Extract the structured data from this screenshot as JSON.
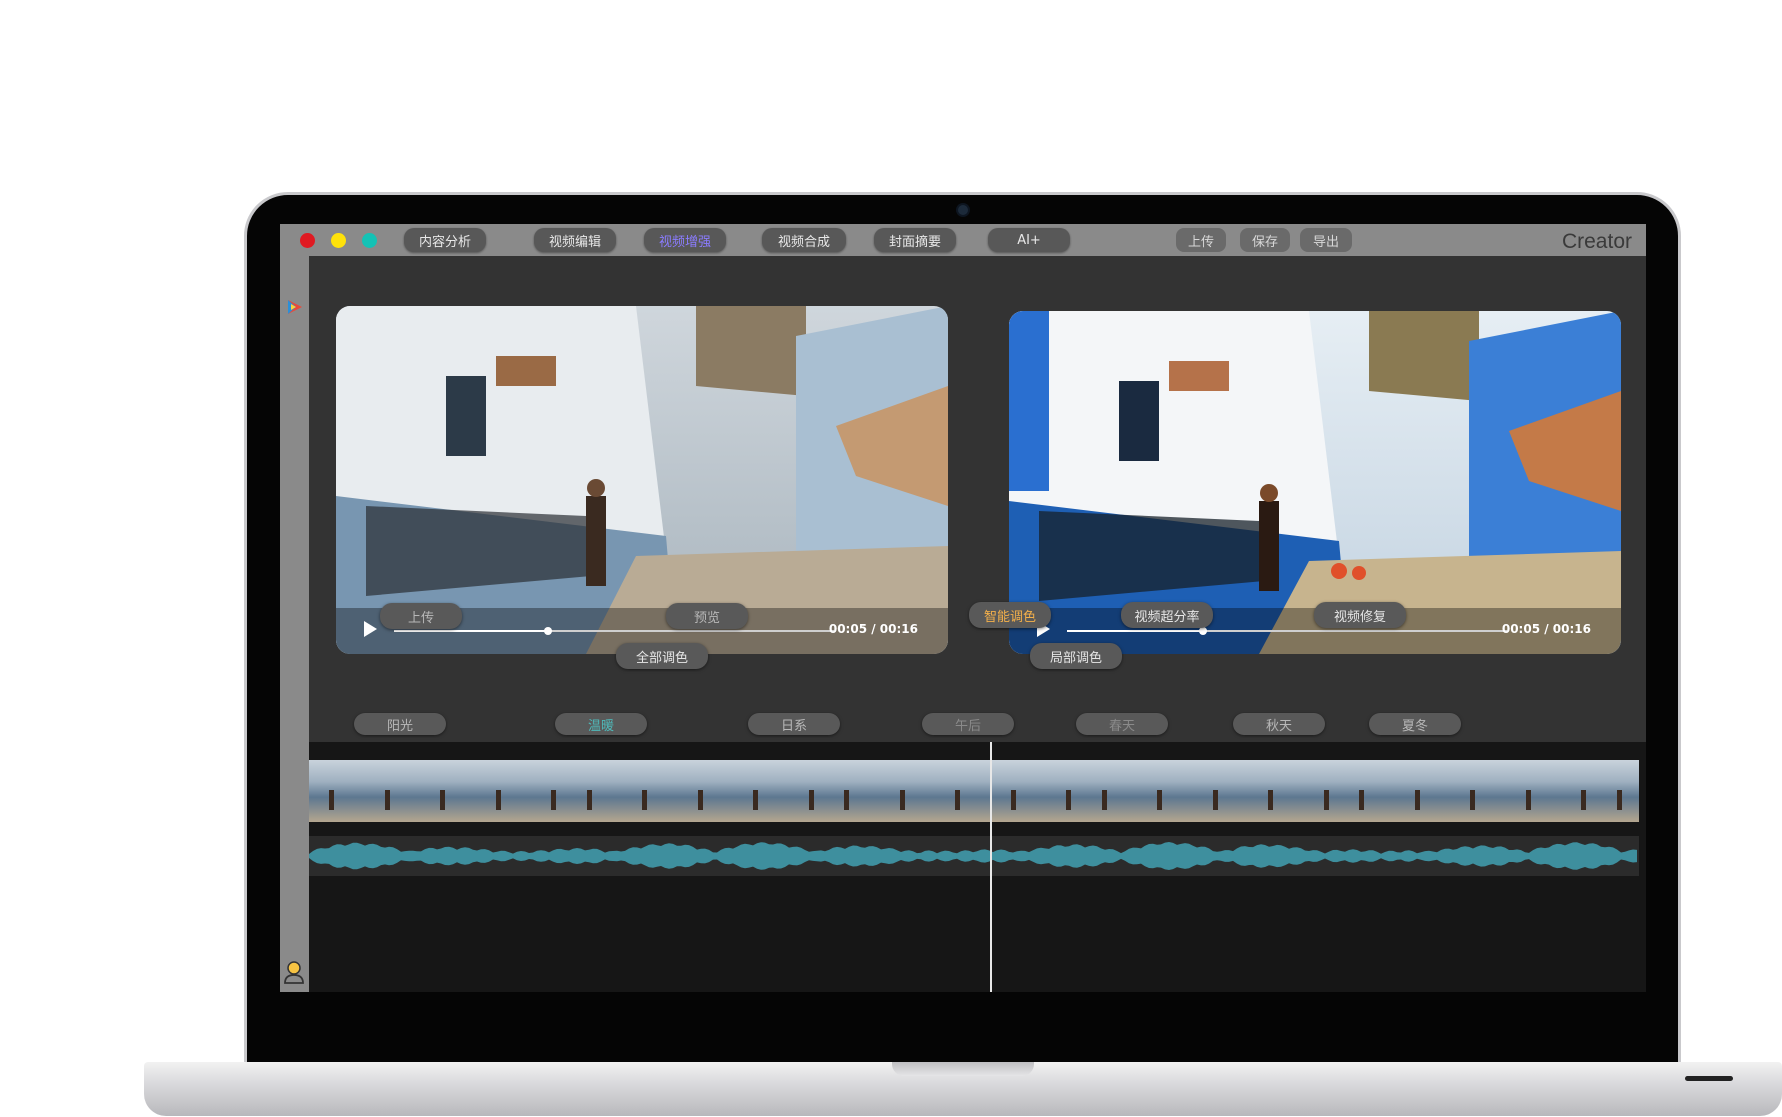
{
  "window": {
    "brand": "Creator",
    "nav_tabs": [
      {
        "label": "内容分析",
        "active": false
      },
      {
        "label": "视频编辑",
        "active": false
      },
      {
        "label": "视频增强",
        "active": true
      },
      {
        "label": "视频合成",
        "active": false
      },
      {
        "label": "封面摘要",
        "active": false
      },
      {
        "label": "AI+",
        "active": false
      }
    ],
    "toolbar": {
      "upload": "上传",
      "save": "保存",
      "export": "导出"
    }
  },
  "players": {
    "original": {
      "time": "00:05 / 00:16",
      "progress": 0.35
    },
    "enhanced": {
      "time": "00:05 / 00:16",
      "progress": 0.31
    }
  },
  "actions": {
    "upload": "上传",
    "preview": "预览",
    "global_grade": "全部调色",
    "smart_grade": "智能调色",
    "super_resolution": "视频超分率",
    "repair": "视频修复",
    "local_grade": "局部调色"
  },
  "presets": [
    "阳光",
    "温暖",
    "日系",
    "午后",
    "春天",
    "秋天",
    "夏冬"
  ],
  "colors": {
    "active_tab": "#8b7cff",
    "smart_grade": "#f4b04a",
    "preset_selected": "#4fb9b9",
    "waveform": "#3e8f9e"
  }
}
